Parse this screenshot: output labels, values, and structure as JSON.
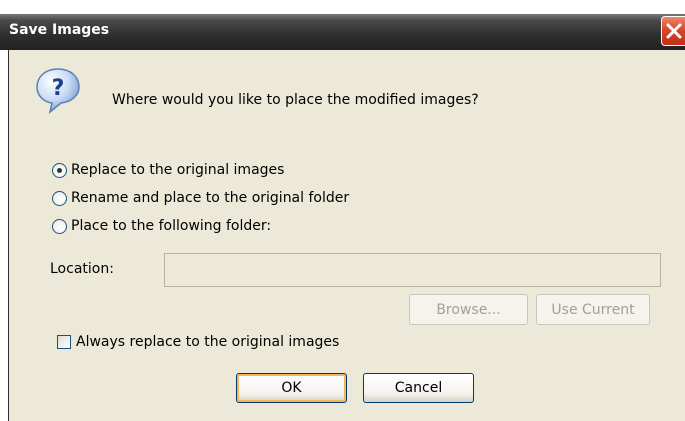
{
  "window": {
    "title": "Save Images"
  },
  "prompt": "Where would you like to place the modified images?",
  "options": [
    {
      "label": "Replace to the original images",
      "checked": true
    },
    {
      "label": "Rename and place to the original folder",
      "checked": false
    },
    {
      "label": "Place to the following folder:",
      "checked": false
    }
  ],
  "location": {
    "label": "Location:",
    "value": ""
  },
  "buttons": {
    "browse": "Browse...",
    "use_current": "Use Current",
    "ok": "OK",
    "cancel": "Cancel"
  },
  "always_replace": {
    "label": "Always replace to the original images",
    "checked": false
  },
  "colors": {
    "titlebar": "#2e2e2e",
    "client_bg": "#ece9d8",
    "close_button": "#d8482a",
    "default_button_focus": "#f9b35a"
  },
  "icons": {
    "dialog": "question-icon",
    "close": "close-icon"
  }
}
